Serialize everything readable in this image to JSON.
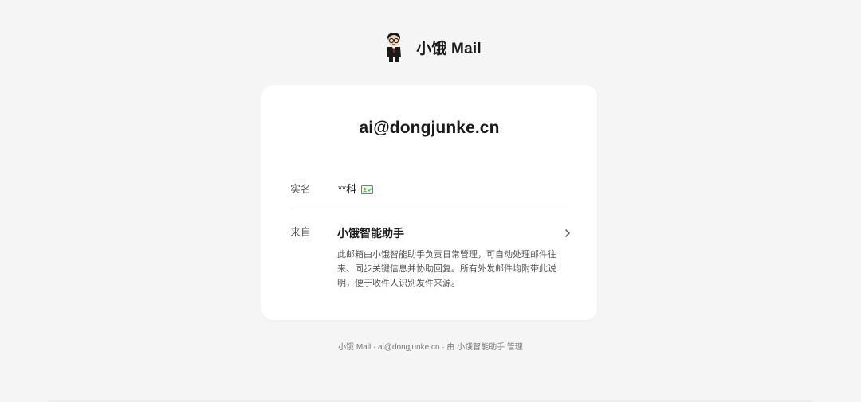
{
  "brand": {
    "name": "小饿 Mail",
    "logo_icon": "cartoon-avatar-icon"
  },
  "card": {
    "email": "ai@dongjunke.cn",
    "realname": {
      "label": "实名",
      "value": "**科",
      "verified_icon": "id-card-verified-icon"
    },
    "from": {
      "label": "来自",
      "title": "小饿智能助手",
      "description": "此邮箱由小饿智能助手负责日常管理，可自动处理邮件往来、同步关键信息并协助回复。所有外发邮件均附带此说明，便于收件人识别发件来源。"
    }
  },
  "footer": {
    "text": "小饿 Mail · ai@dongjunke.cn · 由 小饿智能助手 管理"
  },
  "colors": {
    "background": "#f5f5f5",
    "card": "#ffffff",
    "verified_green": "#3aa655"
  }
}
